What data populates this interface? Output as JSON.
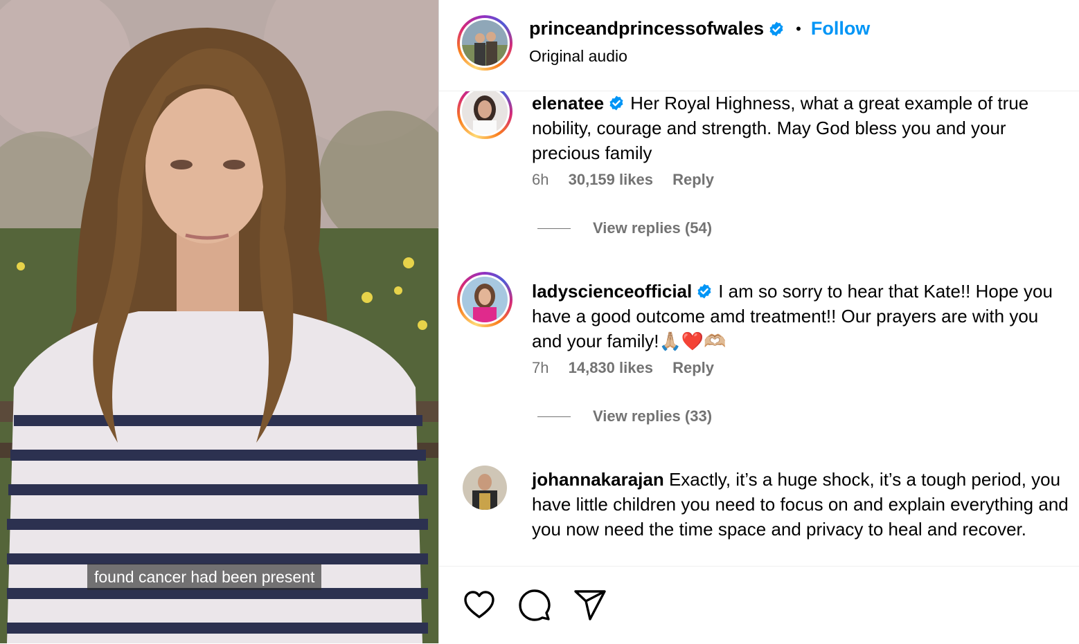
{
  "video": {
    "subtitle": "found cancer had been present"
  },
  "post": {
    "username": "princeandprincessofwales",
    "follow_label": "Follow",
    "separator": "•",
    "audio": "Original audio"
  },
  "comments": [
    {
      "username": "elenatee",
      "verified": true,
      "text": "Her Royal Highness, what a great example of true nobility, courage and strength. May God bless you and your precious family",
      "time": "6h",
      "likes": "30,159 likes",
      "reply_label": "Reply",
      "view_replies": "View replies (54)"
    },
    {
      "username": "ladyscienceofficial",
      "verified": true,
      "text": "I am so sorry to hear that Kate!! Hope you have a good outcome amd treatment!! Our prayers are with you and your family!🙏🏼❤️🫶🏼",
      "time": "7h",
      "likes": "14,830 likes",
      "reply_label": "Reply",
      "view_replies": "View replies (33)"
    },
    {
      "username": "johannakarajan",
      "verified": false,
      "text": "Exactly, it’s a huge shock, it’s a tough period, you have little children you need to focus on and explain everything and you now need the time space and privacy to heal and recover."
    }
  ],
  "actions": {
    "icons": [
      "heart-icon",
      "comment-icon",
      "share-icon"
    ]
  },
  "colors": {
    "follow": "#0095f6",
    "verified": "#0095f6",
    "meta": "#737373"
  }
}
